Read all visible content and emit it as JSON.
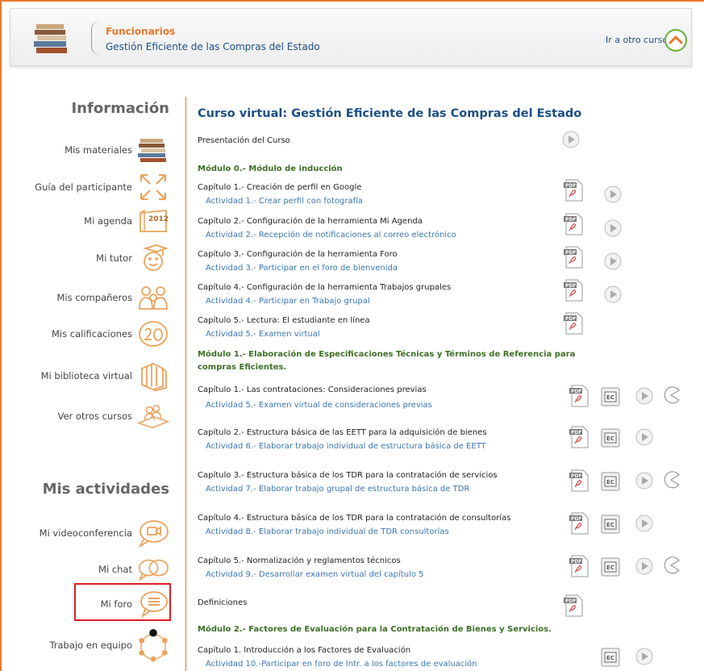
{
  "header": {
    "role": "Funcionarios",
    "course": "Gestión Eficiente de las Compras del Estado",
    "other_course_link": "Ir a otro curso"
  },
  "sidebar": {
    "info_title": "Información",
    "info_items": [
      {
        "label": "Mis materiales",
        "icon": "books-icon"
      },
      {
        "label": "Guía del participante",
        "icon": "arrows-icon"
      },
      {
        "label": "Mi agenda",
        "icon": "calendar-icon"
      },
      {
        "label": "Mi tutor",
        "icon": "tutor-icon"
      },
      {
        "label": "Mis compañeros",
        "icon": "classmates-icon"
      },
      {
        "label": "Mis calificaciones",
        "icon": "grades-icon"
      },
      {
        "label": "Mi biblioteca virtual",
        "icon": "library-icon"
      },
      {
        "label": "Ver otros cursos",
        "icon": "courses-icon"
      }
    ],
    "calendar_year": "2012",
    "activities_title": "Mis actividades",
    "activity_items": [
      {
        "label": "Mi videoconferencia",
        "icon": "videoconference-icon"
      },
      {
        "label": "Mi chat",
        "icon": "chat-icon"
      },
      {
        "label": "Mi foro",
        "icon": "forum-icon"
      },
      {
        "label": "Trabajo en equipo",
        "icon": "team-icon"
      }
    ]
  },
  "main": {
    "title": "Curso virtual: Gestión Eficiente de las Compras del Estado",
    "presentation": "Presentación del Curso",
    "module0": "Módulo 0.- Módulo de inducción",
    "m0": [
      {
        "chapter": "Capítulo 1.- Creación de perfil en Google",
        "activity": "Actividad 1.- Crear perfil con fotografía"
      },
      {
        "chapter": "Capítulo 2.- Configuración de la herramienta Mi Agenda",
        "activity": "Actividad 2.- Recepción de notificaciones al correo electrónico"
      },
      {
        "chapter": "Capítulo 3.- Configuración de la herramienta Foro",
        "activity": "Actividad 3.- Participar en el foro de bienvenida"
      },
      {
        "chapter": "Capítulo 4.- Configuración de la herramienta Trabajos grupales",
        "activity": "Actividad 4.- Participar en Trabajo grupal"
      },
      {
        "chapter": "Capítulo 5.- Lectura: El estudiante en línea",
        "activity": "Actividad 5.- Examen virtual"
      }
    ],
    "module1_line1": "Módulo 1.- Elaboración de Especificaciones Técnicas y Términos de Referencia para",
    "module1_line2": "compras Eficientes.",
    "m1": [
      {
        "chapter": "Capítulo 1.- Las contrataciones: Consideraciones previas",
        "activity": "Actividad 5.- Examen virtual de consideraciones previas"
      },
      {
        "chapter": "Capítulo 2.- Estructura básica de las EETT para la adquisición de bienes",
        "activity": "Actividad 6.- Elaborar trabajo individual de estructura básica de EETT"
      },
      {
        "chapter": "Capítulo 3.- Estructura básica de los TDR para la contratación de servicios",
        "activity": "Actividad 7.- Elaborar trabajo grupal de estructura básica de TDR"
      },
      {
        "chapter": "Capítulo 4.- Estructura básica de los TDR para la contratación de consultorías",
        "activity": "Actividad 8.- Elaborar trabajo individual de TDR consultorías"
      },
      {
        "chapter": "Capítulo 5.- Normalización y reglamentos técnicos",
        "activity": "Actividad 9.- Desarrollar examen virtual del capítulo 5"
      }
    ],
    "definitions": "Definiciones",
    "module2": "Módulo 2.- Factores de Evaluación para la Contratación de Bienes y Servicios.",
    "m2": [
      {
        "chapter": "Capítulo 1. Introducción a los Factores de Evaluación",
        "activity": "Actividad 10.-Participar en foro de Intr. a los factores de evaluación"
      }
    ],
    "pdf_label": "PDF",
    "ec_label": "EC",
    "accent": "#e9792c",
    "link_color": "#3b77b5",
    "title_color": "#1c4f86",
    "module_color": "#3d6f26"
  }
}
